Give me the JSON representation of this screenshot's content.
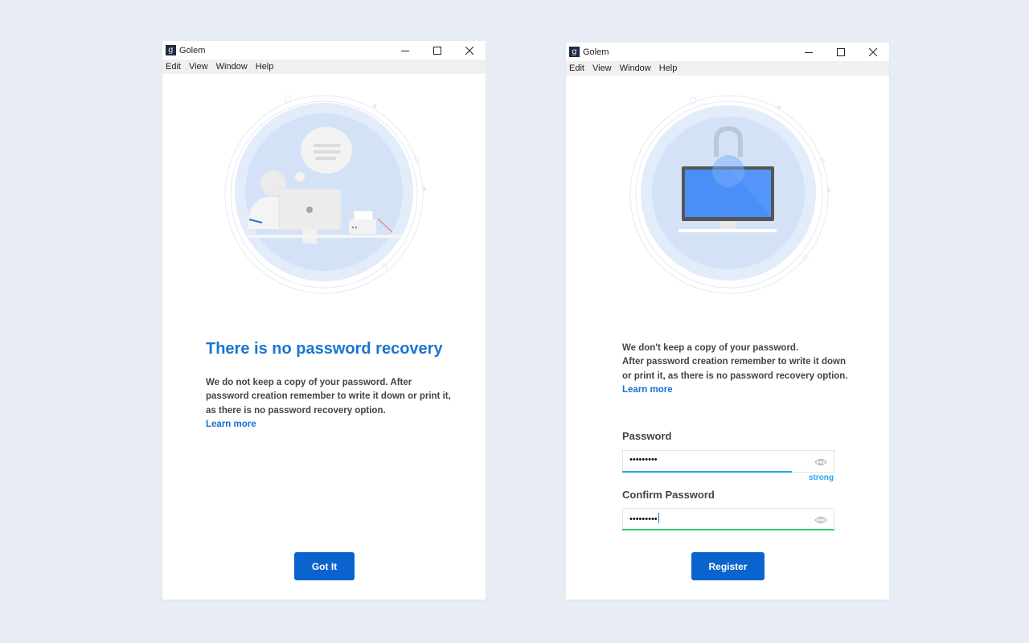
{
  "windows": [
    {
      "app_title": "Golem",
      "app_logo": "g",
      "menu": [
        "Edit",
        "View",
        "Window",
        "Help"
      ],
      "heading": "There is no password recovery",
      "body": "We do not keep a copy of your password. After password creation remember to write it down or print it, as there is no password recovery option.",
      "learn_more": "Learn more",
      "button": "Got It"
    },
    {
      "app_title": "Golem",
      "app_logo": "g",
      "menu": [
        "Edit",
        "View",
        "Window",
        "Help"
      ],
      "body_lines": [
        "We don't keep a copy of your password.",
        "After password creation remember to write it down",
        "or print it, as there is no password recovery option."
      ],
      "learn_more": "Learn more",
      "password": {
        "label": "Password",
        "value": "•••••••••",
        "strength": "strong",
        "strength_fraction": 0.8
      },
      "confirm": {
        "label": "Confirm Password",
        "value": "•••••••••"
      },
      "button": "Register"
    }
  ],
  "colors": {
    "accent": "#0b63ce",
    "heading": "#1976d2",
    "strength": "#1fa7e8",
    "match": "#2ecc71",
    "background": "#e8edf5"
  },
  "icons": {
    "minimize": "minimize-icon",
    "maximize": "maximize-icon",
    "close": "close-icon",
    "visibility": "eye-icon"
  }
}
